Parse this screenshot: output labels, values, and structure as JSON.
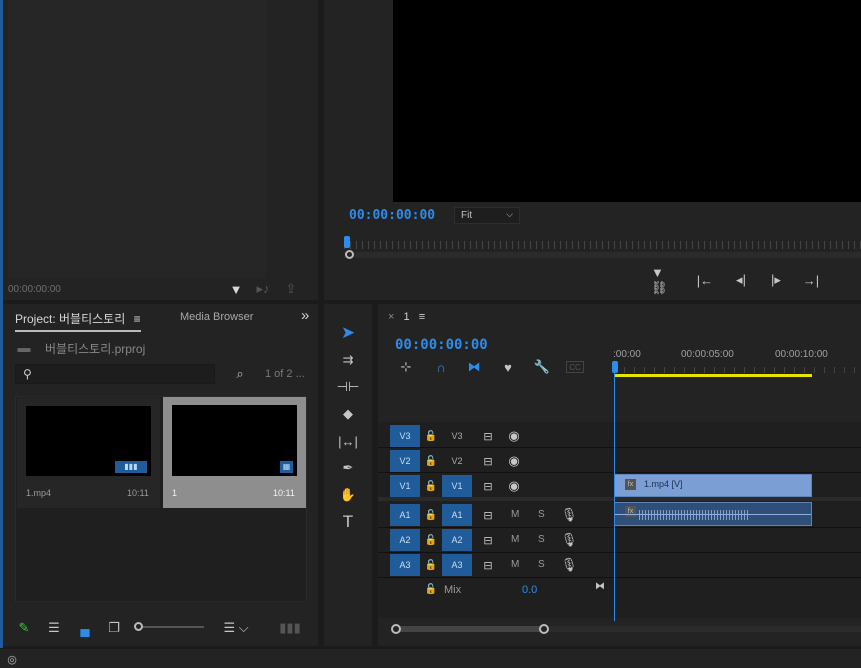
{
  "source_monitor": {
    "timecode": "00:00:00:00"
  },
  "program_monitor": {
    "timecode": "00:00:00:00",
    "fit_select": "Fit"
  },
  "project_panel": {
    "tab_project": "Project: 버블티스토리",
    "tab_menu_icon": "≡",
    "tab_media_browser": "Media Browser",
    "overflow": "»",
    "project_file": "버블티스토리.prproj",
    "search_placeholder": "",
    "page_count": "1 of 2 ...",
    "items": [
      {
        "name": "1.mp4",
        "duration": "10:11"
      },
      {
        "name": "1",
        "duration": "10:11"
      }
    ]
  },
  "timeline": {
    "tab_close": "×",
    "tab_label": "1",
    "tab_menu_icon": "≡",
    "timecode": "00:00:00:00",
    "ruler": [
      ":00:00",
      "00:00:05:00",
      "00:00:10:00"
    ],
    "video_tracks": [
      {
        "patch": "V3",
        "label": "V3"
      },
      {
        "patch": "V2",
        "label": "V2"
      },
      {
        "patch": "V1",
        "label": "V1"
      }
    ],
    "audio_tracks": [
      {
        "patch": "A1",
        "label": "A1",
        "m": "M",
        "s": "S"
      },
      {
        "patch": "A2",
        "label": "A2",
        "m": "M",
        "s": "S"
      },
      {
        "patch": "A3",
        "label": "A3",
        "m": "M",
        "s": "S"
      }
    ],
    "mix_label": "Mix",
    "mix_value": "0.0",
    "video_clip": "1.mp4 [V]"
  },
  "colors": {
    "accent": "#2d8ceb",
    "track_patch": "#1f5c99",
    "clip_video": "#7b9fd4",
    "work_area": "#e5e500"
  }
}
